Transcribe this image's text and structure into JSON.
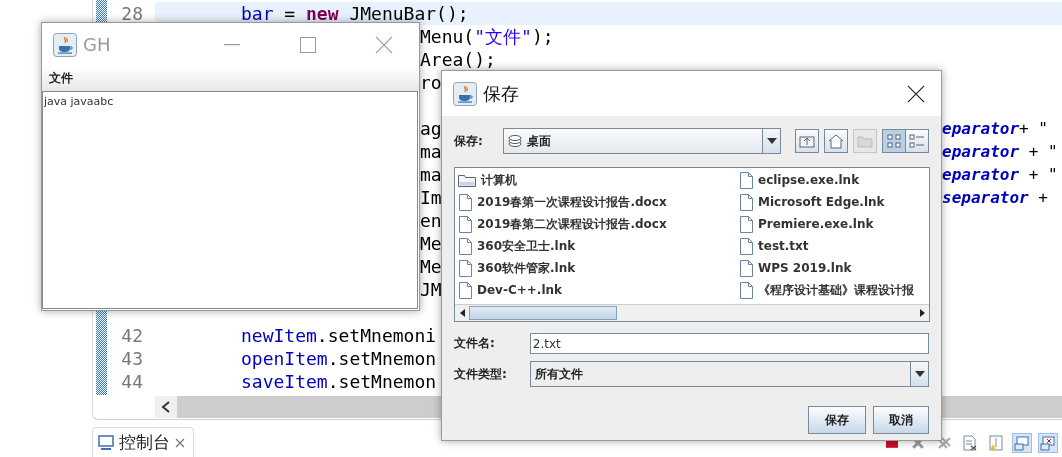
{
  "editor": {
    "lines": [
      {
        "number": "28",
        "current": true,
        "fragments": [
          {
            "kind": "code",
            "parts": [
              {
                "text": "bar",
                "kind": "field"
              },
              {
                "text": " = ",
                "kind": "plain"
              },
              {
                "text": "new",
                "kind": "keyword"
              },
              {
                "text": " JMenuBar();",
                "kind": "plain"
              }
            ]
          }
        ]
      },
      {
        "current": false,
        "fragments": [
          {
            "kind": "mid",
            "parts": [
              {
                "text": "Menu(",
                "kind": "plain"
              },
              {
                "text": "\"文件\"",
                "kind": "string"
              },
              {
                "text": ");",
                "kind": "plain"
              }
            ]
          }
        ]
      },
      {
        "current": false,
        "fragments": [
          {
            "kind": "mid",
            "parts": [
              {
                "text": "Area();",
                "kind": "plain"
              }
            ]
          }
        ]
      },
      {
        "current": false,
        "fragments": [
          {
            "kind": "mid",
            "parts": [
              {
                "text": "ro",
                "kind": "plain"
              }
            ]
          }
        ]
      },
      {
        "current": false
      },
      {
        "current": false,
        "fragments": [
          {
            "kind": "mid",
            "parts": [
              {
                "text": "ag",
                "kind": "plain"
              }
            ]
          },
          {
            "kind": "right",
            "parts": [
              {
                "text": "eparator",
                "kind": "static"
              },
              {
                "text": "+ \"",
                "kind": "plain"
              }
            ]
          }
        ]
      },
      {
        "current": false,
        "fragments": [
          {
            "kind": "mid",
            "parts": [
              {
                "text": "ma",
                "kind": "plain"
              }
            ]
          },
          {
            "kind": "right",
            "parts": [
              {
                "text": "eparator",
                "kind": "static"
              },
              {
                "text": " + \"",
                "kind": "plain"
              }
            ]
          }
        ]
      },
      {
        "current": false,
        "fragments": [
          {
            "kind": "mid",
            "parts": [
              {
                "text": "ma",
                "kind": "plain"
              }
            ]
          },
          {
            "kind": "right",
            "parts": [
              {
                "text": "eparator",
                "kind": "static"
              },
              {
                "text": " + \"",
                "kind": "plain"
              }
            ]
          }
        ]
      },
      {
        "current": false,
        "fragments": [
          {
            "kind": "mid",
            "parts": [
              {
                "text": "Im",
                "kind": "plain"
              }
            ]
          },
          {
            "kind": "right",
            "parts": [
              {
                "text": "separator",
                "kind": "static"
              },
              {
                "text": " +",
                "kind": "plain"
              }
            ]
          }
        ]
      },
      {
        "current": false,
        "fragments": [
          {
            "kind": "mid",
            "parts": [
              {
                "text": "en",
                "kind": "plain"
              }
            ]
          }
        ]
      },
      {
        "current": false,
        "fragments": [
          {
            "kind": "mid",
            "parts": [
              {
                "text": "Me",
                "kind": "plain"
              }
            ]
          }
        ]
      },
      {
        "current": false,
        "fragments": [
          {
            "kind": "mid",
            "parts": [
              {
                "text": "Me",
                "kind": "plain"
              }
            ]
          }
        ]
      },
      {
        "current": false,
        "fragments": [
          {
            "kind": "mid",
            "parts": [
              {
                "text": "JM",
                "kind": "plain"
              }
            ]
          }
        ]
      },
      {
        "current": false
      },
      {
        "number": "42",
        "current": false,
        "fragments": [
          {
            "kind": "code",
            "parts": [
              {
                "text": "newItem",
                "kind": "field"
              },
              {
                "text": ".setMnemoni",
                "kind": "plain"
              }
            ]
          }
        ]
      },
      {
        "number": "43",
        "current": false,
        "fragments": [
          {
            "kind": "code",
            "parts": [
              {
                "text": "openItem",
                "kind": "field"
              },
              {
                "text": ".setMnemon",
                "kind": "plain"
              }
            ]
          }
        ]
      },
      {
        "number": "44",
        "current": false,
        "fragments": [
          {
            "kind": "code",
            "parts": [
              {
                "text": "saveItem",
                "kind": "field"
              },
              {
                "text": ".setMnemon",
                "kind": "plain"
              }
            ]
          }
        ]
      }
    ]
  },
  "console": {
    "tabs": [
      {
        "label": "控制台",
        "selected": true
      }
    ],
    "toolbar": [
      {
        "kind": "terminate",
        "selected": false
      },
      {
        "kind": "remove",
        "selected": false
      },
      {
        "kind": "remove-all",
        "selected": false
      },
      {
        "kind": "clear",
        "selected": false
      },
      {
        "kind": "scroll-lock",
        "selected": false
      },
      {
        "kind": "show-out",
        "selected": true
      },
      {
        "kind": "show-err",
        "selected": true
      }
    ]
  },
  "gh_window": {
    "title": "GH",
    "menu": [
      "文件"
    ],
    "text": "java javaabc"
  },
  "save_dialog": {
    "title": "保存",
    "look_in_label": "保存:",
    "look_in_value": "桌面",
    "toolbar": [
      {
        "kind": "up",
        "disabled": false,
        "selected": false
      },
      {
        "kind": "home",
        "disabled": false,
        "selected": false
      },
      {
        "kind": "new-folder",
        "disabled": true,
        "selected": false
      },
      {
        "kind": "list",
        "disabled": false,
        "selected": true
      },
      {
        "kind": "details",
        "disabled": false,
        "selected": false
      }
    ],
    "files": [
      {
        "name": "计算机",
        "kind": "folder"
      },
      {
        "name": "2019春第一次课程设计报告.docx",
        "kind": "file"
      },
      {
        "name": "2019春第二次课程设计报告.docx",
        "kind": "file"
      },
      {
        "name": "360安全卫士.lnk",
        "kind": "file"
      },
      {
        "name": "360软件管家.lnk",
        "kind": "file"
      },
      {
        "name": "Dev-C++.lnk",
        "kind": "file"
      },
      {
        "name": "eclipse.exe.lnk",
        "kind": "file"
      },
      {
        "name": "Microsoft Edge.lnk",
        "kind": "file"
      },
      {
        "name": "Premiere.exe.lnk",
        "kind": "file"
      },
      {
        "name": "test.txt",
        "kind": "file"
      },
      {
        "name": "WPS 2019.lnk",
        "kind": "file"
      },
      {
        "name": "《程序设计基础》课程设计报",
        "kind": "file"
      }
    ],
    "file_name_label": "文件名:",
    "file_name": "2.txt",
    "file_type_label": "文件类型:",
    "file_type": "所有文件",
    "buttons": [
      "保存",
      "取消"
    ]
  }
}
